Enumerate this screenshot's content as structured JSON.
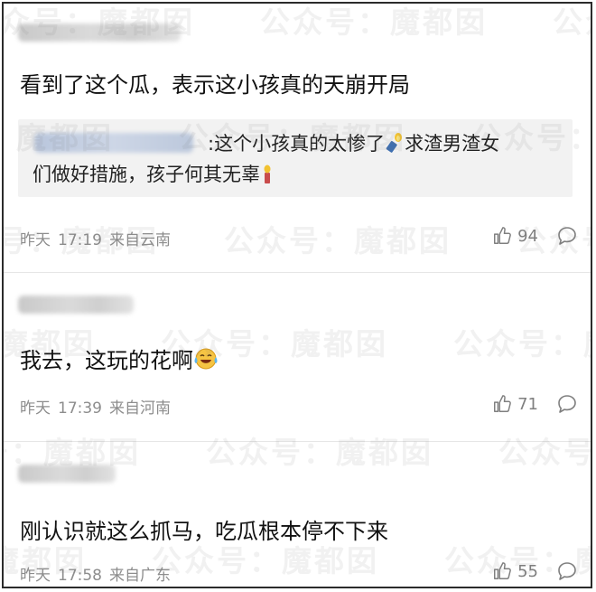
{
  "watermark": {
    "text": "公众号：魔都囡"
  },
  "comments": [
    {
      "username": "blurred",
      "content": "看到了这个瓜，表示这小孩真的天崩开局",
      "quote": {
        "username": "blurred",
        "text_line1": ":这个小孩真的太惨了",
        "text_line1b": "求渣男渣女",
        "text_line2": "们做好措施，孩子何其无辜"
      },
      "date": "昨天",
      "time": "17:19",
      "location": "来自云南",
      "likes": "94"
    },
    {
      "username": "blurred",
      "content": "我去，这玩的花啊",
      "date": "昨天",
      "time": "17:39",
      "location": "来自河南",
      "likes": "71"
    },
    {
      "username": "blurred",
      "content": "刚认识就这么抓马，吃瓜根本停不下来",
      "date": "昨天",
      "time": "17:58",
      "location": "来自广东",
      "likes": "55"
    }
  ],
  "icons": {
    "like": "thumbs-up-icon",
    "reply": "comment-bubble-icon",
    "emoji_candle": "candle-emoji-icon",
    "emoji_tears": "laughing-tears-emoji-icon"
  }
}
